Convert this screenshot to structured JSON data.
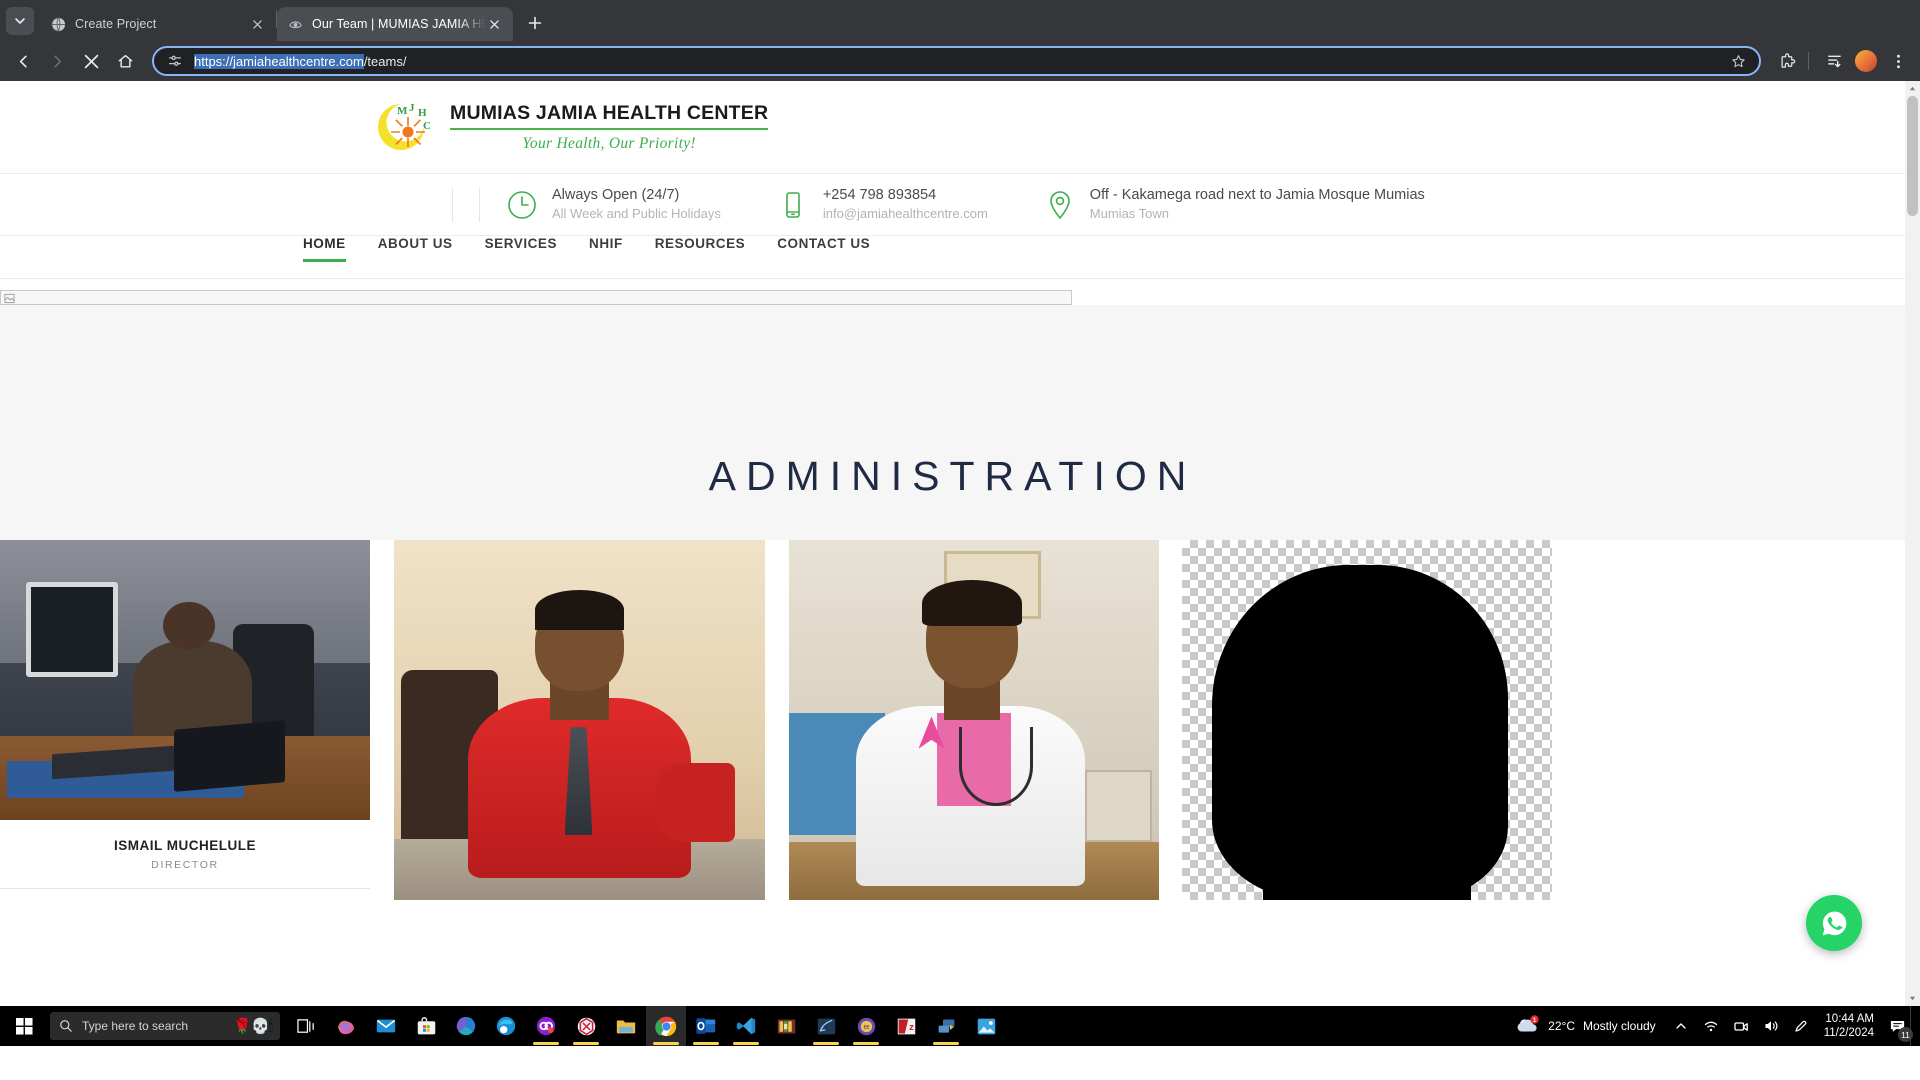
{
  "browser": {
    "tabs": [
      {
        "title": "Create Project",
        "favicon": "globe-icon",
        "active": false
      },
      {
        "title": "Our Team | MUMIAS JAMIA HEA",
        "favicon": "site-icon",
        "active": true
      }
    ],
    "new_tab_label": "+",
    "url_selected": "https://jamiahealthcentre.com",
    "url_rest": "/teams/",
    "full_url": "https://jamiahealthcentre.com/teams/",
    "accent": "#8ab4f8"
  },
  "site": {
    "logo": {
      "initials": "M J H C",
      "name": "MUMIAS JAMIA HEALTH CENTER",
      "tagline": "Your Health, Our Priority!"
    },
    "contact": [
      {
        "icon": "clock-icon",
        "primary": "Always Open (24/7)",
        "secondary": "All Week and Public Holidays"
      },
      {
        "icon": "phone-icon",
        "primary": "+254 798 893854",
        "secondary": "info@jamiahealthcentre.com"
      },
      {
        "icon": "location-pin-icon",
        "primary": "Off - Kakamega road next to Jamia Mosque Mumias",
        "secondary": "Mumias Town"
      }
    ],
    "nav": [
      {
        "label": "HOME",
        "active": true
      },
      {
        "label": "ABOUT US",
        "active": false
      },
      {
        "label": "SERVICES",
        "active": false
      },
      {
        "label": "NHIF",
        "active": false
      },
      {
        "label": "RESOURCES",
        "active": false
      },
      {
        "label": "CONTACT US",
        "active": false
      }
    ],
    "section_title": "ADMINISTRATION",
    "team": [
      {
        "name": "ISMAIL MUCHELULE",
        "role": "DIRECTOR"
      },
      {
        "name": "",
        "role": ""
      },
      {
        "name": "",
        "role": ""
      },
      {
        "name": "",
        "role": ""
      }
    ],
    "whatsapp_label": "whatsapp-icon",
    "green": "#3cae4f"
  },
  "taskbar": {
    "search_placeholder": "Type here to search",
    "search_emoji": "🌹💀🕯",
    "apps": [
      "task-view-icon",
      "copilot-icon",
      "mail-icon",
      "microsoft-store-icon",
      "office-icon",
      "edge-icon",
      "opera-gx-icon",
      "netbeans-icon",
      "file-explorer-icon",
      "google-chrome-icon",
      "outlook-icon",
      "vs-code-icon",
      "winrar-icon",
      "blender-icon",
      "jakarta-ee-icon",
      "filezilla-icon",
      "remote-desktop-icon",
      "photos-icon"
    ],
    "weather": {
      "temp": "22°C",
      "condition": "Mostly cloudy"
    },
    "tray_icons": [
      "chevron-up-icon",
      "wifi-icon",
      "camera-icon",
      "volume-icon",
      "pen-icon"
    ],
    "time": "10:44 AM",
    "date": "11/2/2024",
    "notification_count": "11"
  }
}
